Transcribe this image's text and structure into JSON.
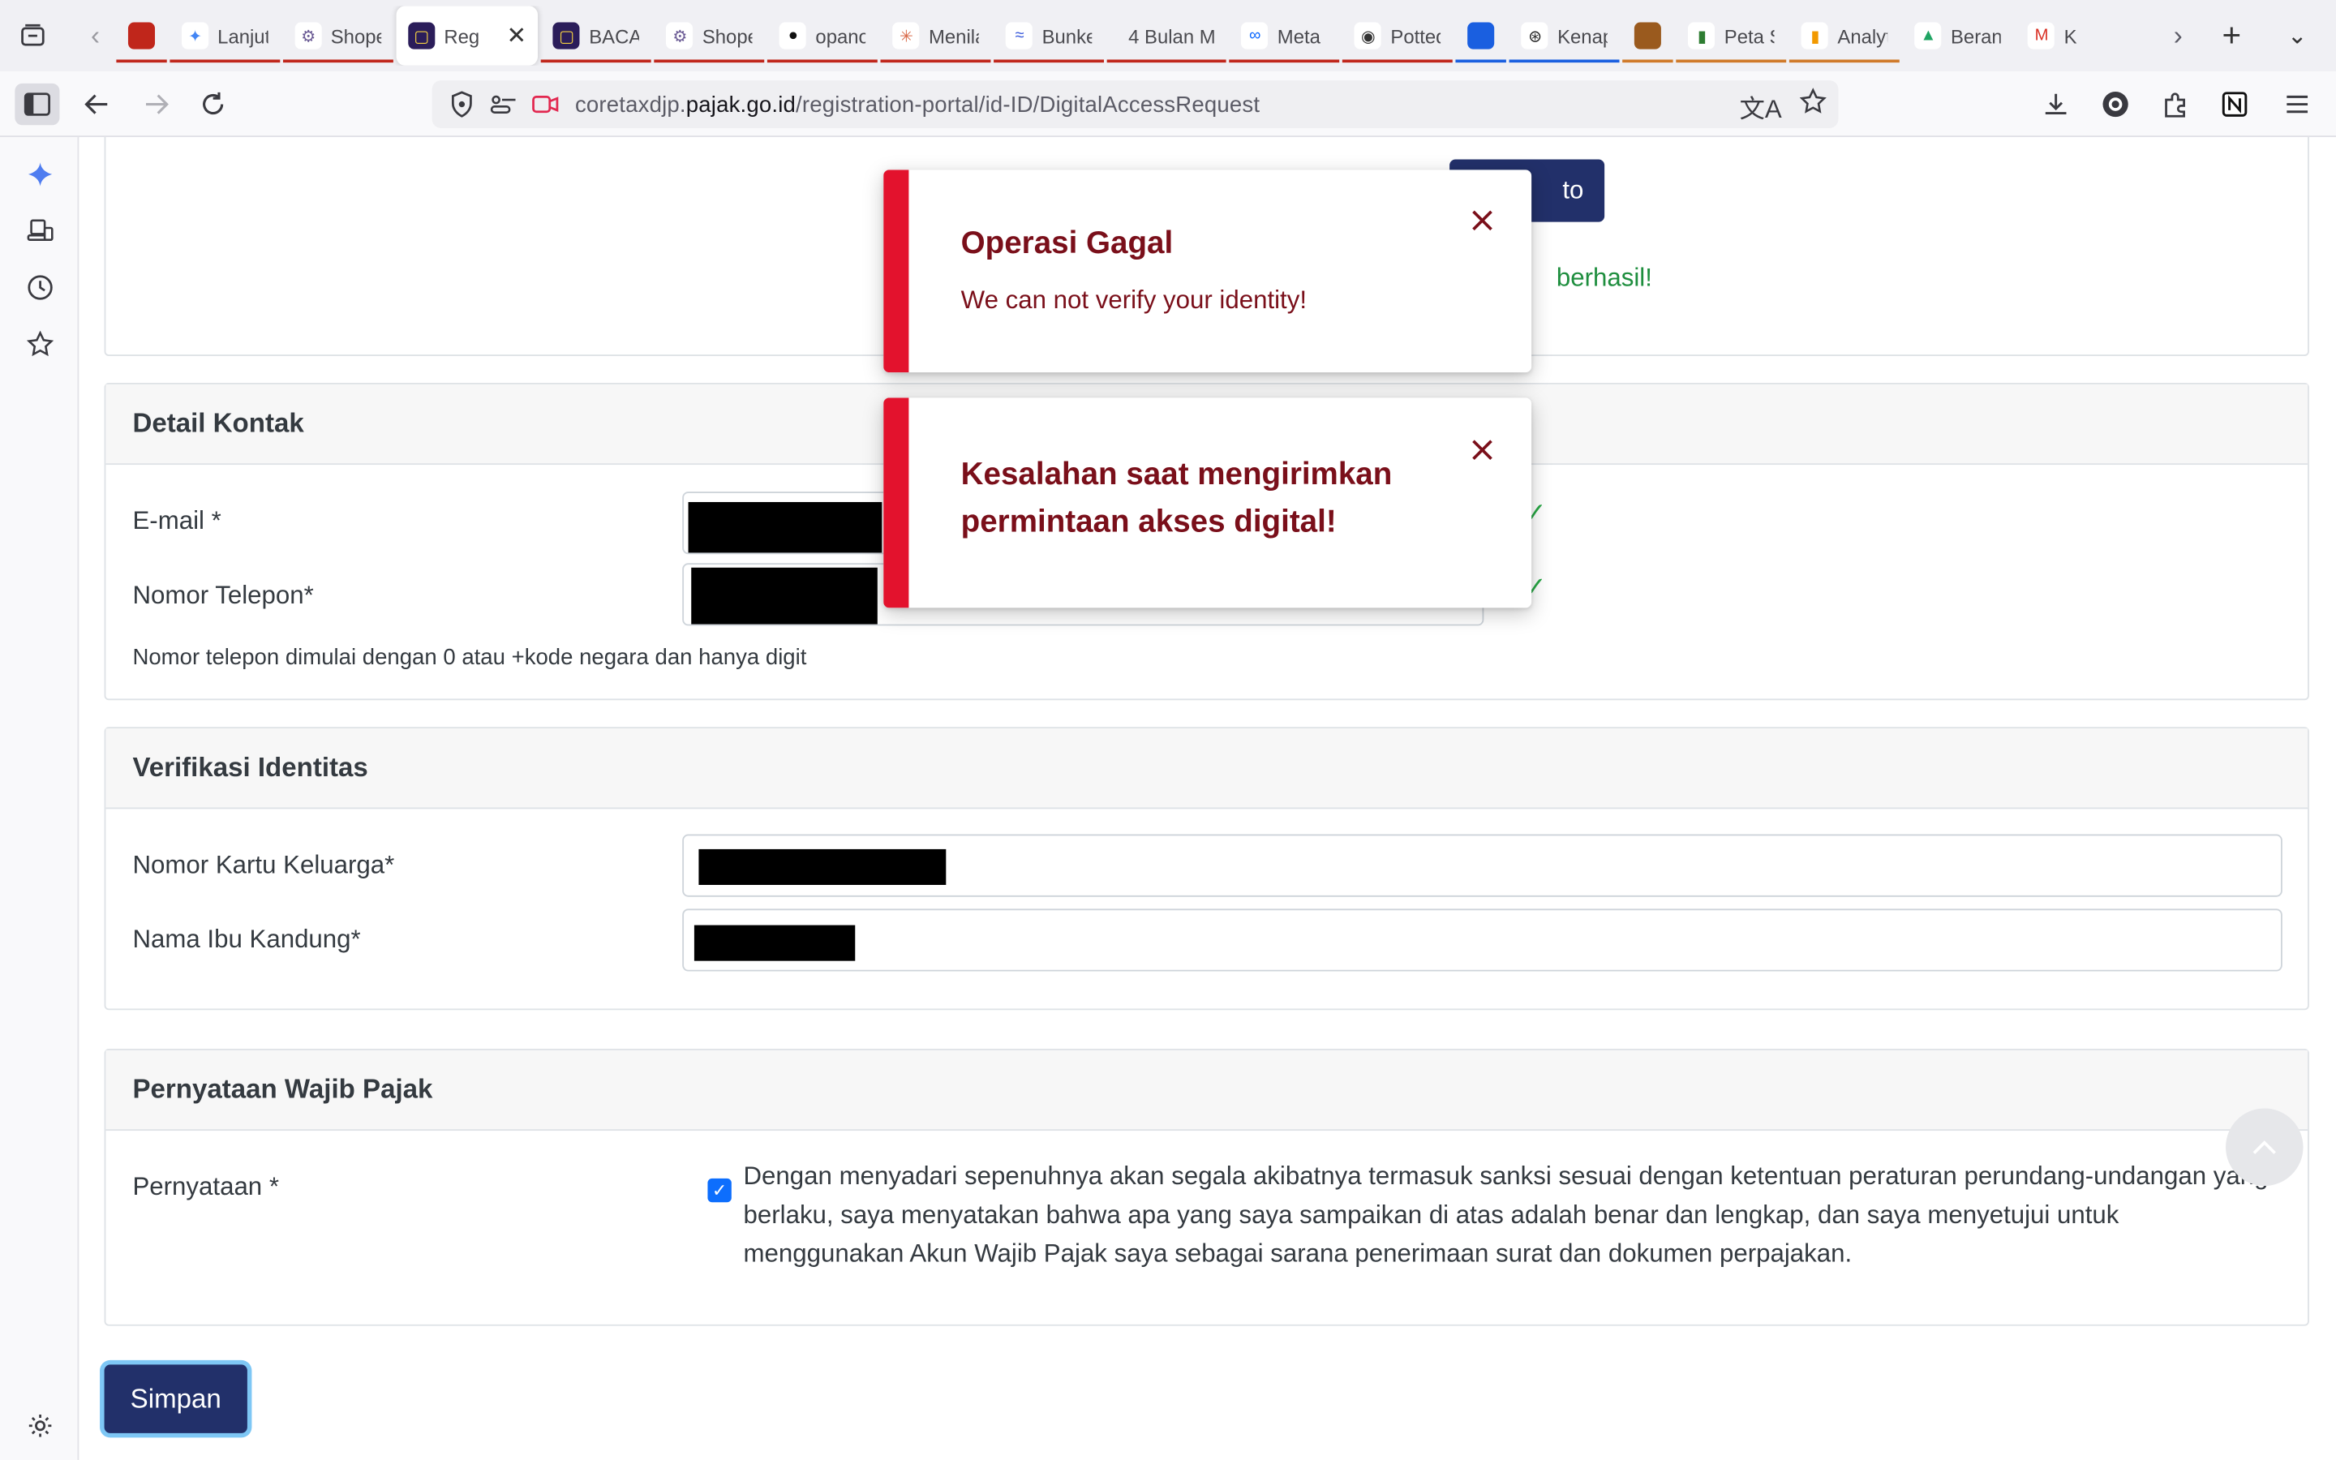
{
  "browser": {
    "tabs": [
      {
        "label": "",
        "favicon_color": "#c0261b",
        "favicon_glyph": "",
        "underline": "#c0261b"
      },
      {
        "label": "Lanjut",
        "favicon_color": "#ffffff",
        "favicon_glyph": "✦",
        "glyph_color": "#4285f4",
        "underline": "#c0261b"
      },
      {
        "label": "Shope",
        "favicon_color": "#ffffff",
        "favicon_glyph": "⚙",
        "glyph_color": "#6b5b95",
        "underline": "#c0261b"
      },
      {
        "label": "Reg",
        "favicon_color": "#2b1d5a",
        "favicon_glyph": "▢",
        "glyph_color": "#f5d142",
        "active": true,
        "underline": ""
      },
      {
        "label": "BACA",
        "favicon_color": "#2b1d5a",
        "favicon_glyph": "▢",
        "glyph_color": "#f5d142",
        "underline": "#c0261b"
      },
      {
        "label": "Shope",
        "favicon_color": "#ffffff",
        "favicon_glyph": "⚙",
        "glyph_color": "#6b5b95",
        "underline": "#c0261b"
      },
      {
        "label": "opano",
        "favicon_color": "#ffffff",
        "favicon_glyph": "●",
        "glyph_color": "#111111",
        "underline": "#c0261b"
      },
      {
        "label": "Menila",
        "favicon_color": "#ffffff",
        "favicon_glyph": "✳",
        "glyph_color": "#d96b4a",
        "underline": "#c0261b"
      },
      {
        "label": "Bunke",
        "favicon_color": "#ffffff",
        "favicon_glyph": "≈",
        "glyph_color": "#3b5bdb",
        "underline": "#c0261b"
      },
      {
        "label": "4 Bulan M",
        "favicon_color": "transparent",
        "favicon_glyph": "",
        "underline": "#c0261b"
      },
      {
        "label": "Meta I",
        "favicon_color": "#ffffff",
        "favicon_glyph": "∞",
        "glyph_color": "#0866ff",
        "underline": "#c0261b"
      },
      {
        "label": "Potted",
        "favicon_color": "#ffffff",
        "favicon_glyph": "◉",
        "glyph_color": "#333333",
        "underline": "#c0261b"
      },
      {
        "label": "",
        "favicon_color": "#1a5fe0",
        "favicon_glyph": "",
        "underline": "#1a5fe0"
      },
      {
        "label": "Kenap",
        "favicon_color": "#ffffff",
        "favicon_glyph": "⊛",
        "glyph_color": "#222222",
        "underline": "#1a5fe0"
      },
      {
        "label": "",
        "favicon_color": "#9a5a1e",
        "favicon_glyph": "",
        "underline": "#d07a2a"
      },
      {
        "label": "Peta S",
        "favicon_color": "#ffffff",
        "favicon_glyph": "▮",
        "glyph_color": "#2e7d32",
        "underline": "#d07a2a"
      },
      {
        "label": "Analyt",
        "favicon_color": "#ffffff",
        "favicon_glyph": "▮",
        "glyph_color": "#f29900",
        "underline": "#d07a2a"
      },
      {
        "label": "Beran",
        "favicon_color": "#ffffff",
        "favicon_glyph": "▲",
        "glyph_color": "#1fa463",
        "underline": ""
      },
      {
        "label": "K",
        "favicon_color": "#ffffff",
        "favicon_glyph": "M",
        "glyph_color": "#d93025",
        "underline": ""
      }
    ],
    "url": {
      "prefix": "coretaxdjp.",
      "host": "pajak.go.id",
      "path": "/registration-portal/id-ID/DigitalAccessRequest"
    }
  },
  "top_section": {
    "button_fragment": "to",
    "success_fragment": "berhasil!"
  },
  "contact": {
    "title": "Detail Kontak",
    "email_label": "E-mail *",
    "phone_label": "Nomor Telepon*",
    "phone_help": "Nomor telepon dimulai dengan 0 atau +kode negara dan hanya digit"
  },
  "identity": {
    "title": "Verifikasi Identitas",
    "kk_label": "Nomor Kartu Keluarga*",
    "mother_label": "Nama Ibu Kandung*"
  },
  "statement": {
    "title": "Pernyataan Wajib Pajak",
    "label": "Pernyataan *",
    "text": "Dengan menyadari sepenuhnya akan segala akibatnya termasuk sanksi sesuai dengan ketentuan peraturan perundang-undangan yang berlaku, saya menyatakan bahwa apa yang saya sampaikan di atas adalah benar dan lengkap, dan saya menyetujui untuk menggunakan Akun Wajib Pajak saya sebagai sarana penerimaan surat dan dokumen perpajakan.",
    "checked": true
  },
  "save_label": "Simpan",
  "toasts": [
    {
      "title": "Operasi Gagal",
      "message": "We can not verify your identity!"
    },
    {
      "title": "Kesalahan saat mengirimkan permintaan akses digital!",
      "message": ""
    }
  ],
  "colors": {
    "primary": "#22306a",
    "error_stripe": "#e3122d",
    "error_text": "#7a0f1a",
    "success": "#1e8e3e"
  }
}
